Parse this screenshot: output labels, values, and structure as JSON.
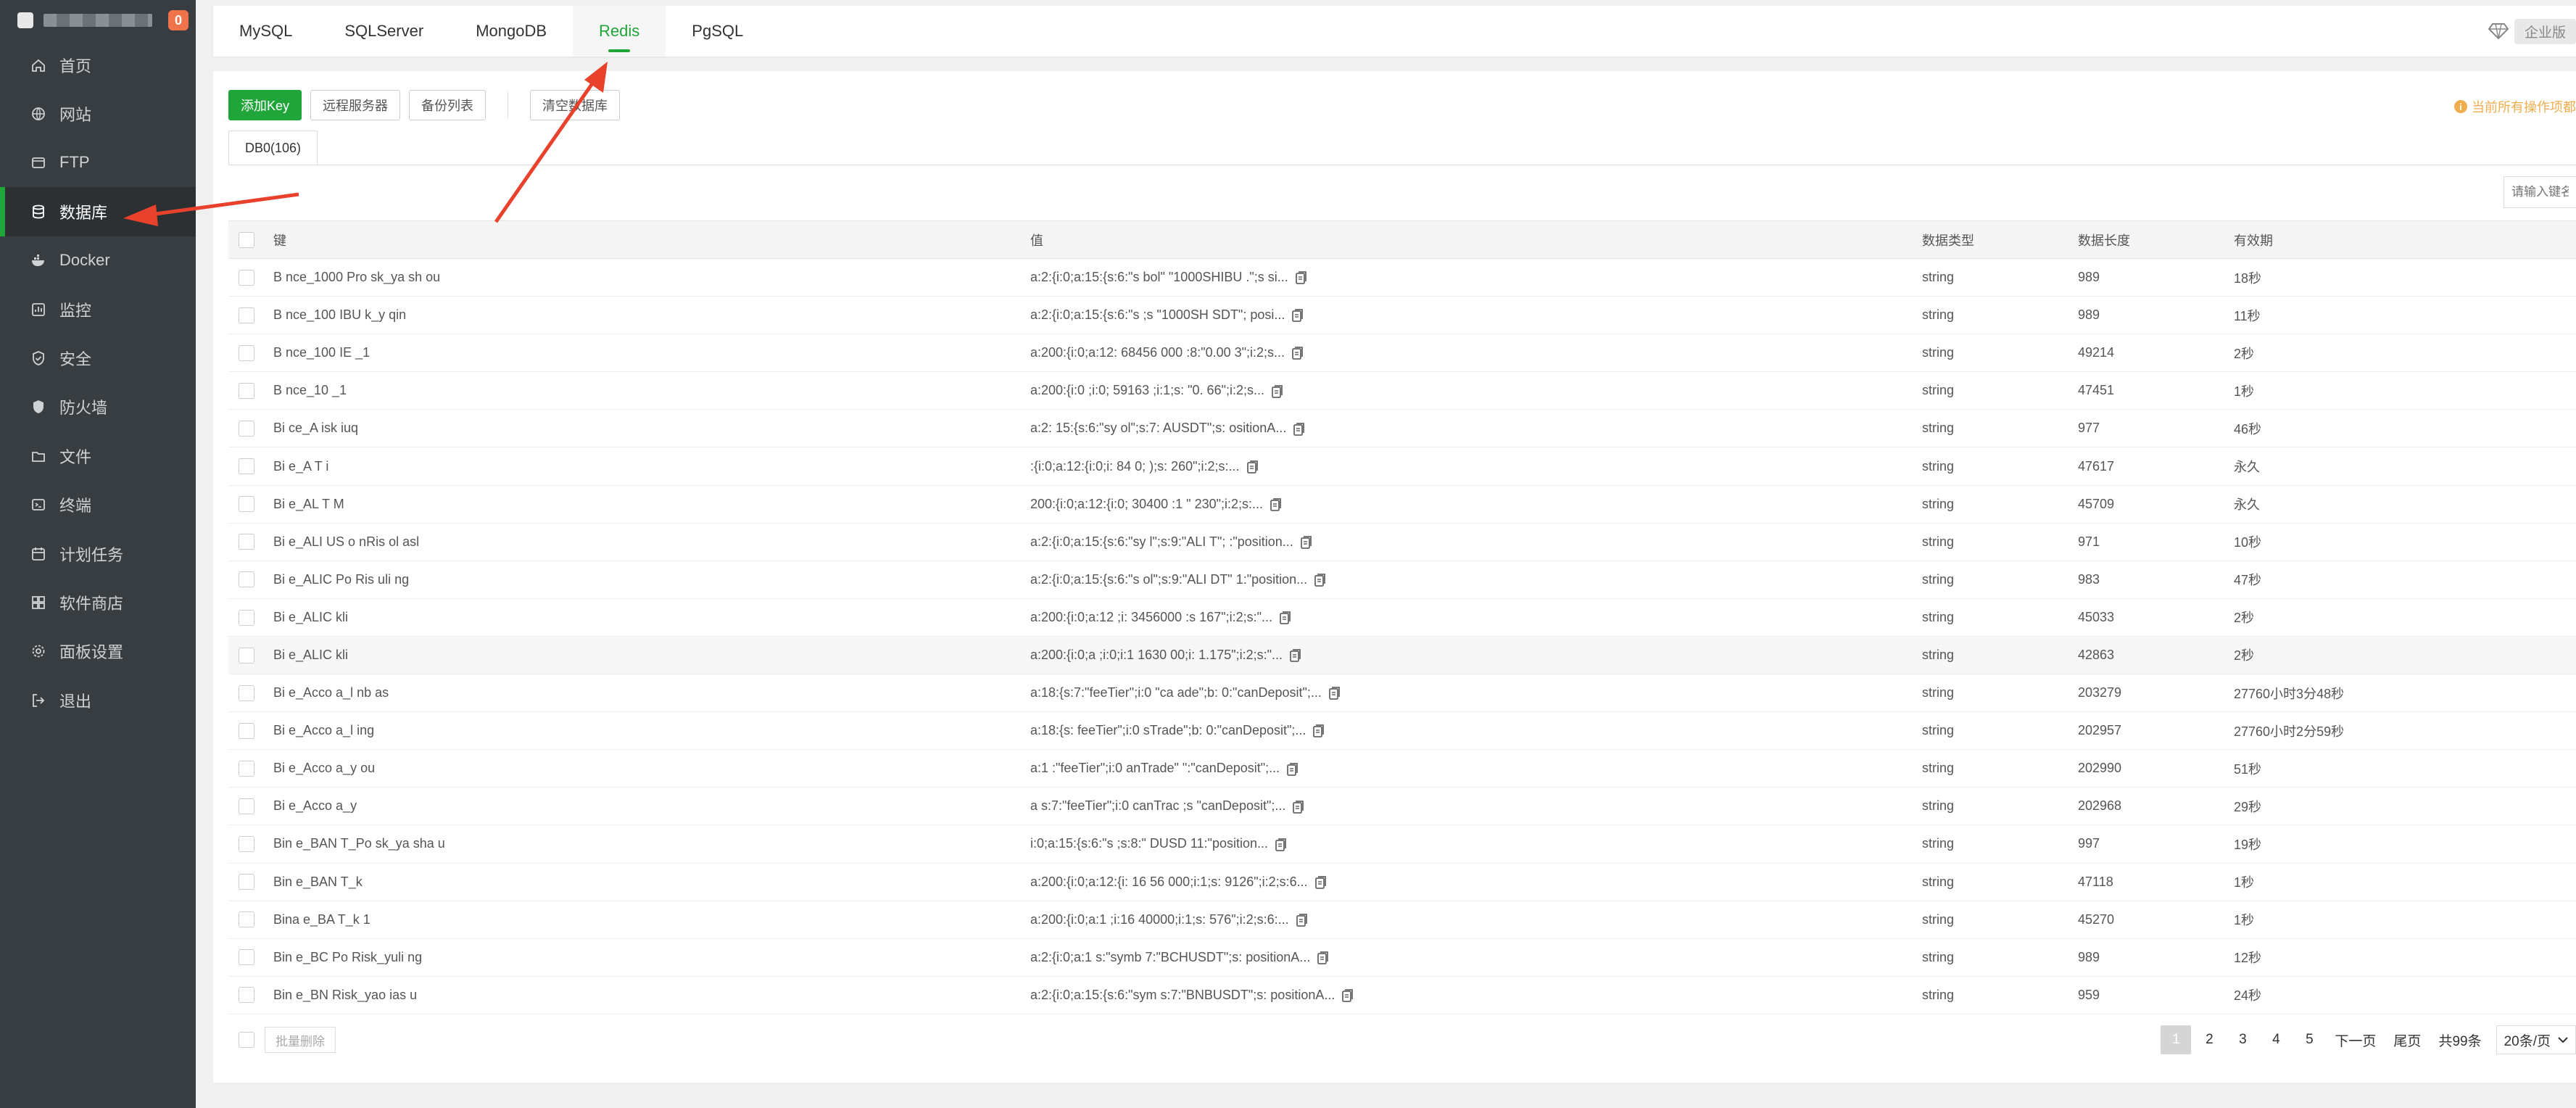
{
  "sidebar": {
    "badge": "0",
    "items": [
      {
        "label": "首页",
        "icon": "home-icon"
      },
      {
        "label": "网站",
        "icon": "globe-icon"
      },
      {
        "label": "FTP",
        "icon": "ftp-icon"
      },
      {
        "label": "数据库",
        "icon": "database-icon",
        "active": true
      },
      {
        "label": "Docker",
        "icon": "docker-icon"
      },
      {
        "label": "监控",
        "icon": "monitor-icon"
      },
      {
        "label": "安全",
        "icon": "shield-icon"
      },
      {
        "label": "防火墙",
        "icon": "firewall-icon"
      },
      {
        "label": "文件",
        "icon": "folder-icon"
      },
      {
        "label": "终端",
        "icon": "terminal-icon"
      },
      {
        "label": "计划任务",
        "icon": "calendar-icon"
      },
      {
        "label": "软件商店",
        "icon": "apps-icon"
      },
      {
        "label": "面板设置",
        "icon": "settings-icon"
      },
      {
        "label": "退出",
        "icon": "logout-icon"
      }
    ]
  },
  "tabs": [
    "MySQL",
    "SQLServer",
    "MongoDB",
    "Redis",
    "PgSQL"
  ],
  "active_tab": "Redis",
  "edition": "企业版",
  "toolbar": {
    "add_key": "添加Key",
    "remote_server": "远程服务器",
    "backup_list": "备份列表",
    "clear_db": "清空数据库"
  },
  "notice": "当前所有操作项都",
  "db_tab": "DB0(106)",
  "search": {
    "placeholder": "请输入键名"
  },
  "columns": {
    "key": "键",
    "value": "值",
    "type": "数据类型",
    "length": "数据长度",
    "ttl": "有效期"
  },
  "rows": [
    {
      "key": "B   nce_1000      Pro     sk_ya   sh   ou",
      "value": "a:2:{i:0;a:15:{s:6:\"s   bol\"     \"1000SHIBU   .\";s     si...",
      "type": "string",
      "length": "989",
      "ttl": "18秒"
    },
    {
      "key": "B   nce_100   IBU         k_y   qin",
      "value": "a:2:{i:0;a:15:{s:6:\"s     ;s     \"1000SH   SDT\";     posi...",
      "type": "string",
      "length": "989",
      "ttl": "11秒"
    },
    {
      "key": "B   nce_100   IE        _1",
      "value": "a:200:{i:0;a:12:    68456     000    :8:\"0.00   3\";i:2;s...",
      "type": "string",
      "length": "49214",
      "ttl": "2秒"
    },
    {
      "key": "B   nce_10          _1",
      "value": "a:200:{i:0    ;i:0;    59163     ;i:1;s:    \"0.   66\";i:2;s...",
      "type": "string",
      "length": "47451",
      "ttl": "1秒"
    },
    {
      "key": "Bi   ce_A        isk   iuq",
      "value": "a:2:    15:{s:6:\"sy   ol\";s:7:    AUSDT\";s:    ositionA...",
      "type": "string",
      "length": "977",
      "ttl": "46秒"
    },
    {
      "key": "Bi   e_A      T      i",
      "value": "    :{i:0;a:12:{i:0;i:   84   0;    );s:    260\";i:2;s:...",
      "type": "string",
      "length": "47617",
      "ttl": "永久"
    },
    {
      "key": "Bi   e_AL    T    M",
      "value": "    200:{i:0;a:12:{i:0;     30400   :1    \"   230\";i:2;s:...",
      "type": "string",
      "length": "45709",
      "ttl": "永久"
    },
    {
      "key": "Bi   e_ALI  US     o   nRis   ol   asl",
      "value": "a:2:{i:0;a:15:{s:6:\"sy   l\";s:9:\"ALI    T\";    :\"position...",
      "type": "string",
      "length": "971",
      "ttl": "10秒"
    },
    {
      "key": "Bi   e_ALIC   Po   Ris   uli   ng",
      "value": "a:2:{i:0;a:15:{s:6:\"s   ol\";s:9:\"ALI    DT\"   1:\"position...",
      "type": "string",
      "length": "983",
      "ttl": "47秒"
    },
    {
      "key": "Bi   e_ALIC   kli",
      "value": "a:200:{i:0;a:12    ;i:    3456000    :s    167\";i:2;s:\"...",
      "type": "string",
      "length": "45033",
      "ttl": "2秒"
    },
    {
      "key": "Bi   e_ALIC   kli",
      "value": "a:200:{i:0;a   ;i:0;i:1   1630   00;i:    1.175\";i:2;s:\"...",
      "type": "string",
      "length": "42863",
      "ttl": "2秒"
    },
    {
      "key": "Bi   e_Acco   a_l   nb   as",
      "value": "a:18:{s:7:\"feeTier\";i:0   \"ca   ade\";b:   0:\"canDeposit\";...",
      "type": "string",
      "length": "203279",
      "ttl": "27760小时3分48秒"
    },
    {
      "key": "Bi   e_Acco   a_l   ing",
      "value": "a:18:{s:   feeTier\";i:0    sTrade\";b:   0:\"canDeposit\";...",
      "type": "string",
      "length": "202957",
      "ttl": "27760小时2分59秒"
    },
    {
      "key": "Bi   e_Acco   a_y   ou",
      "value": "a:1   :\"feeTier\";i:0   anTrade\"     \":\"canDeposit\";...",
      "type": "string",
      "length": "202990",
      "ttl": "51秒"
    },
    {
      "key": "Bi   e_Acco   a_y",
      "value": "a   s:7:\"feeTier\";i:0   canTrac   ;s   \"canDeposit\";...",
      "type": "string",
      "length": "202968",
      "ttl": "29秒"
    },
    {
      "key": "Bin   e_BAN   T_Po   sk_ya   sha   u",
      "value": "   i:0;a:15:{s:6:\"s   ;s:8:\"   DUSD   11:\"position...",
      "type": "string",
      "length": "997",
      "ttl": "19秒"
    },
    {
      "key": "Bin   e_BAN   T_k",
      "value": "a:200:{i:0;a:12:{i:   16    56   000;i:1;s:   9126\";i:2;s:6...",
      "type": "string",
      "length": "47118",
      "ttl": "1秒"
    },
    {
      "key": "Bina   e_BA   T_k   1",
      "value": "a:200:{i:0;a:1   ;i:16    40000;i:1;s:   576\";i:2;s:6:...",
      "type": "string",
      "length": "45270",
      "ttl": "1秒"
    },
    {
      "key": "Bin   e_BC   Po   Risk_yuli   ng",
      "value": "a:2:{i:0;a:1   s:\"symb   7:\"BCHUSDT\";s:   positionA...",
      "type": "string",
      "length": "989",
      "ttl": "12秒"
    },
    {
      "key": "Bin   e_BN   Risk_yao   ias   u",
      "value": "a:2:{i:0;a:15:{s:6:\"sym   s:7:\"BNBUSDT\";s:   positionA...",
      "type": "string",
      "length": "959",
      "ttl": "24秒"
    }
  ],
  "footer": {
    "batch_delete": "批量删除",
    "pages": [
      "1",
      "2",
      "3",
      "4",
      "5"
    ],
    "next": "下一页",
    "last": "尾页",
    "total": "共99条",
    "per_page": "20条/页"
  },
  "colors": {
    "accent": "#20a53a",
    "sidebar": "#373d41",
    "annotation": "#e8412c"
  }
}
